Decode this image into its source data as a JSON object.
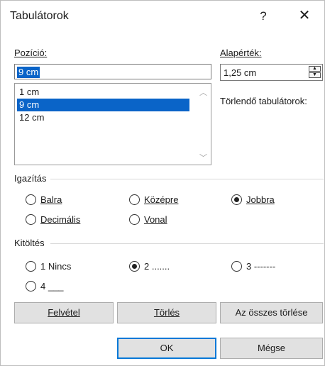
{
  "dialog": {
    "title": "Tabulátorok",
    "help_label": "?",
    "close_label": "✕"
  },
  "position": {
    "label": "Pozíció:",
    "value": "9 cm",
    "list": [
      "1 cm",
      "9 cm",
      "12 cm"
    ],
    "selected_index": 1
  },
  "default_stop": {
    "label": "Alapérték:",
    "value": "1,25 cm"
  },
  "clear_label": "Törlendő tabulátorok:",
  "alignment": {
    "label": "Igazítás",
    "options": [
      {
        "label": "Balra",
        "checked": false
      },
      {
        "label": "Középre",
        "checked": false
      },
      {
        "label": "Jobbra",
        "checked": true
      },
      {
        "label": "Decimális",
        "checked": false
      },
      {
        "label": "Vonal",
        "checked": false
      }
    ]
  },
  "leader": {
    "label": "Kitöltés",
    "options": [
      {
        "label": "1 Nincs",
        "checked": false
      },
      {
        "label": "2 .......",
        "checked": true
      },
      {
        "label": "3 -------",
        "checked": false
      },
      {
        "label": "4 ___",
        "checked": false
      }
    ]
  },
  "buttons": {
    "set": "Felvétel",
    "clear": "Törlés",
    "clear_all": "Az összes törlése",
    "ok": "OK",
    "cancel": "Mégse"
  }
}
